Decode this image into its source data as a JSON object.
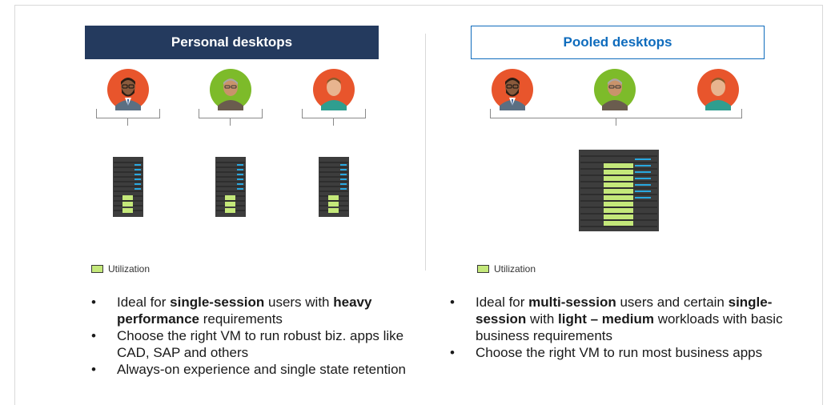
{
  "personal": {
    "title": "Personal desktops",
    "legend": "Utilization",
    "bullets": [
      {
        "parts": [
          "Ideal for ",
          "single-session",
          " users with ",
          "heavy performance",
          " requirements"
        ]
      },
      {
        "parts": [
          "Choose the right VM to run robust biz. apps like CAD, SAP and others"
        ]
      },
      {
        "parts": [
          "Always-on experience and single state retention"
        ]
      }
    ]
  },
  "pooled": {
    "title": "Pooled desktops",
    "legend": "Utilization",
    "bullets": [
      {
        "parts": [
          "Ideal for ",
          "multi-session",
          " users and certain ",
          "single-session",
          " with ",
          "light – medium",
          " workloads with basic business requirements"
        ]
      },
      {
        "parts": [
          "Choose the right VM to run most business apps"
        ]
      }
    ]
  },
  "bullet_char": "•",
  "colors": {
    "header_dark": "#243a5e",
    "header_blue": "#0f6cbd",
    "utilization_green": "#c4e87a",
    "server_body": "#3d3d3d",
    "server_indicator": "#29a8e0"
  },
  "avatars": [
    "avatar-orange-bearded",
    "avatar-green-older",
    "avatar-orange-young"
  ]
}
